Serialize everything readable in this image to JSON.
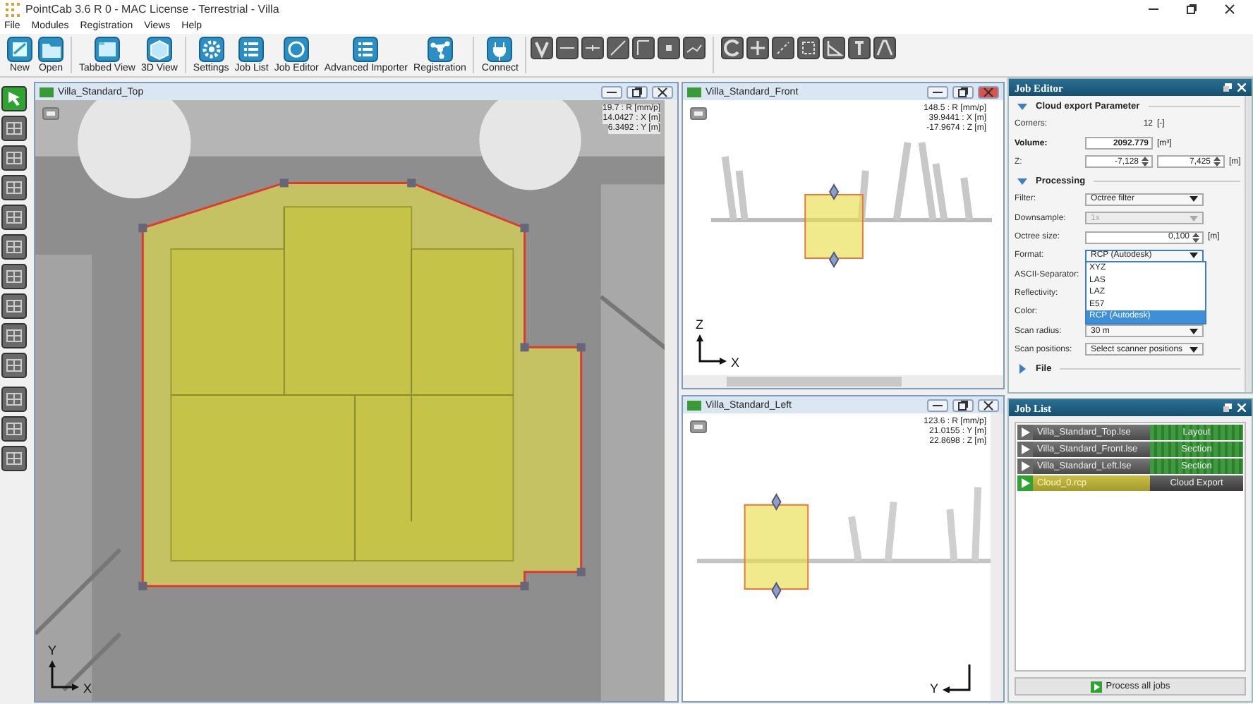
{
  "window": {
    "title": "PointCab 3.6 R 0 - MAC License - Terrestrial - Villa"
  },
  "menu": [
    "File",
    "Modules",
    "Registration",
    "Views",
    "Help"
  ],
  "toolbar": [
    {
      "label": "New",
      "kind": "new"
    },
    {
      "label": "Open",
      "kind": "open"
    },
    {
      "label": "Tabbed View",
      "kind": "tabs"
    },
    {
      "label": "3D View",
      "kind": "cube"
    },
    {
      "label": "Settings",
      "kind": "gear"
    },
    {
      "label": "Job List",
      "kind": "list"
    },
    {
      "label": "Job Editor",
      "kind": "ring"
    },
    {
      "label": "Advanced Importer",
      "kind": "list"
    },
    {
      "label": "Registration",
      "kind": "nodes"
    },
    {
      "label": "Connect",
      "kind": "plug"
    }
  ],
  "left_tools": [
    {
      "selected": true
    },
    {
      "selected": false
    },
    {
      "selected": false
    },
    {
      "selected": false
    },
    {
      "selected": false
    },
    {
      "selected": false
    },
    {
      "selected": false
    },
    {
      "selected": false
    },
    {
      "selected": false
    },
    {
      "selected": false
    },
    {
      "selected": false
    },
    {
      "selected": false
    },
    {
      "selected": false
    }
  ],
  "views": [
    {
      "title": "Villa_Standard_Top",
      "kind": "top",
      "active": false,
      "readouts": [
        "19.7 : R [mm/p]",
        "14.0427 : X [m]",
        "6.3492 : Y [m]"
      ],
      "axis_vertical": "Y",
      "axis_horizontal": "X"
    },
    {
      "title": "Villa_Standard_Front",
      "kind": "front",
      "active": true,
      "readouts": [
        "148.5 : R [mm/p]",
        "39.9441 : X [m]",
        "-17.9674 : Z [m]"
      ],
      "axis_vertical": "Z",
      "axis_horizontal": "X"
    },
    {
      "title": "Villa_Standard_Left",
      "kind": "left",
      "active": false,
      "readouts": [
        "123.6 : R [mm/p]",
        "21.0155 : Y [m]",
        "22.8698 : Z [m]"
      ],
      "axis_horizontal": "Y"
    }
  ],
  "job_editor": {
    "title": "Job Editor",
    "sections": [
      {
        "title": "Cloud export Parameter",
        "expanded": true,
        "rows": [
          {
            "kind": "value",
            "label": "Corners:",
            "value": "12",
            "unit": "[-]"
          },
          {
            "kind": "number",
            "label": "Volume:",
            "strong": true,
            "value": "2092.779",
            "unit": "[m³]"
          },
          {
            "kind": "range",
            "label": "Z:",
            "values": [
              "-7,128",
              "7,425"
            ],
            "unit": "[m]"
          }
        ]
      },
      {
        "title": "Processing",
        "expanded": true,
        "rows": [
          {
            "kind": "select",
            "label": "Filter:",
            "value": "Octree filter",
            "disabled": false
          },
          {
            "kind": "select",
            "label": "Downsample:",
            "value": "1x",
            "disabled": true
          },
          {
            "kind": "spin",
            "label": "Octree size:",
            "value": "0,100",
            "unit": "[m]"
          },
          {
            "kind": "select",
            "label": "Format:",
            "value": "RCP (Autodesk)",
            "disabled": false,
            "open": true,
            "options": [
              {
                "label": "XYZ",
                "selected": false
              },
              {
                "label": "LAS",
                "selected": false
              },
              {
                "label": "LAZ",
                "selected": false
              },
              {
                "label": "E57",
                "selected": false
              },
              {
                "label": "RCP (Autodesk)",
                "selected": true
              }
            ]
          },
          {
            "kind": "plain",
            "label": "ASCII-Separator:"
          },
          {
            "kind": "plain",
            "label": "Reflectivity:"
          },
          {
            "kind": "plain",
            "label": "Color:"
          },
          {
            "kind": "select",
            "label": "Scan radius:",
            "value": "30 m",
            "disabled": false
          },
          {
            "kind": "select",
            "label": "Scan positions:",
            "value": "Select scanner positions",
            "disabled": false
          }
        ]
      },
      {
        "title": "File",
        "expanded": false
      }
    ]
  },
  "job_list": {
    "title": "Job List",
    "jobs": [
      {
        "name": "Villa_Standard_Top.lse",
        "type": "Layout",
        "selected": false
      },
      {
        "name": "Villa_Standard_Front.lse",
        "type": "Section",
        "selected": false
      },
      {
        "name": "Villa_Standard_Left.lse",
        "type": "Section",
        "selected": false
      },
      {
        "name": "Cloud_0.rcp",
        "type": "Cloud Export",
        "selected": true
      }
    ],
    "button": "Process all jobs"
  }
}
